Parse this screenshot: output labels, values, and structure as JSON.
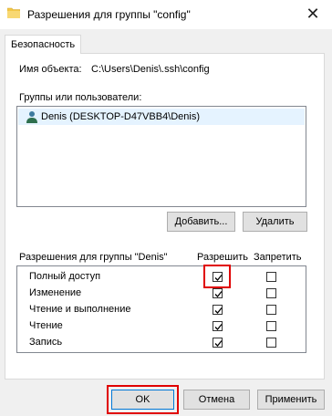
{
  "window": {
    "title": "Разрешения для группы \"config\"",
    "close_glyph": "✕"
  },
  "tabs": [
    {
      "label": "Безопасность"
    }
  ],
  "object": {
    "label": "Имя объекта:",
    "value": "C:\\Users\\Denis\\.ssh\\config"
  },
  "groups": {
    "label": "Группы или пользователи:",
    "items": [
      {
        "name": "Denis (DESKTOP-D47VBB4\\Denis)"
      }
    ]
  },
  "buttons": {
    "add": "Добавить...",
    "remove": "Удалить",
    "ok": "OK",
    "cancel": "Отмена",
    "apply": "Применить"
  },
  "permissions": {
    "label": "Разрешения для группы \"Denis\"",
    "allow_header": "Разрешить",
    "deny_header": "Запретить",
    "rows": [
      {
        "name": "Полный доступ",
        "allow": true,
        "deny": false
      },
      {
        "name": "Изменение",
        "allow": true,
        "deny": false
      },
      {
        "name": "Чтение и выполнение",
        "allow": true,
        "deny": false
      },
      {
        "name": "Чтение",
        "allow": true,
        "deny": false
      },
      {
        "name": "Запись",
        "allow": true,
        "deny": false
      }
    ]
  },
  "colors": {
    "highlight": "#e00000",
    "selection": "#e5f3ff",
    "folder": "#f3c746"
  }
}
